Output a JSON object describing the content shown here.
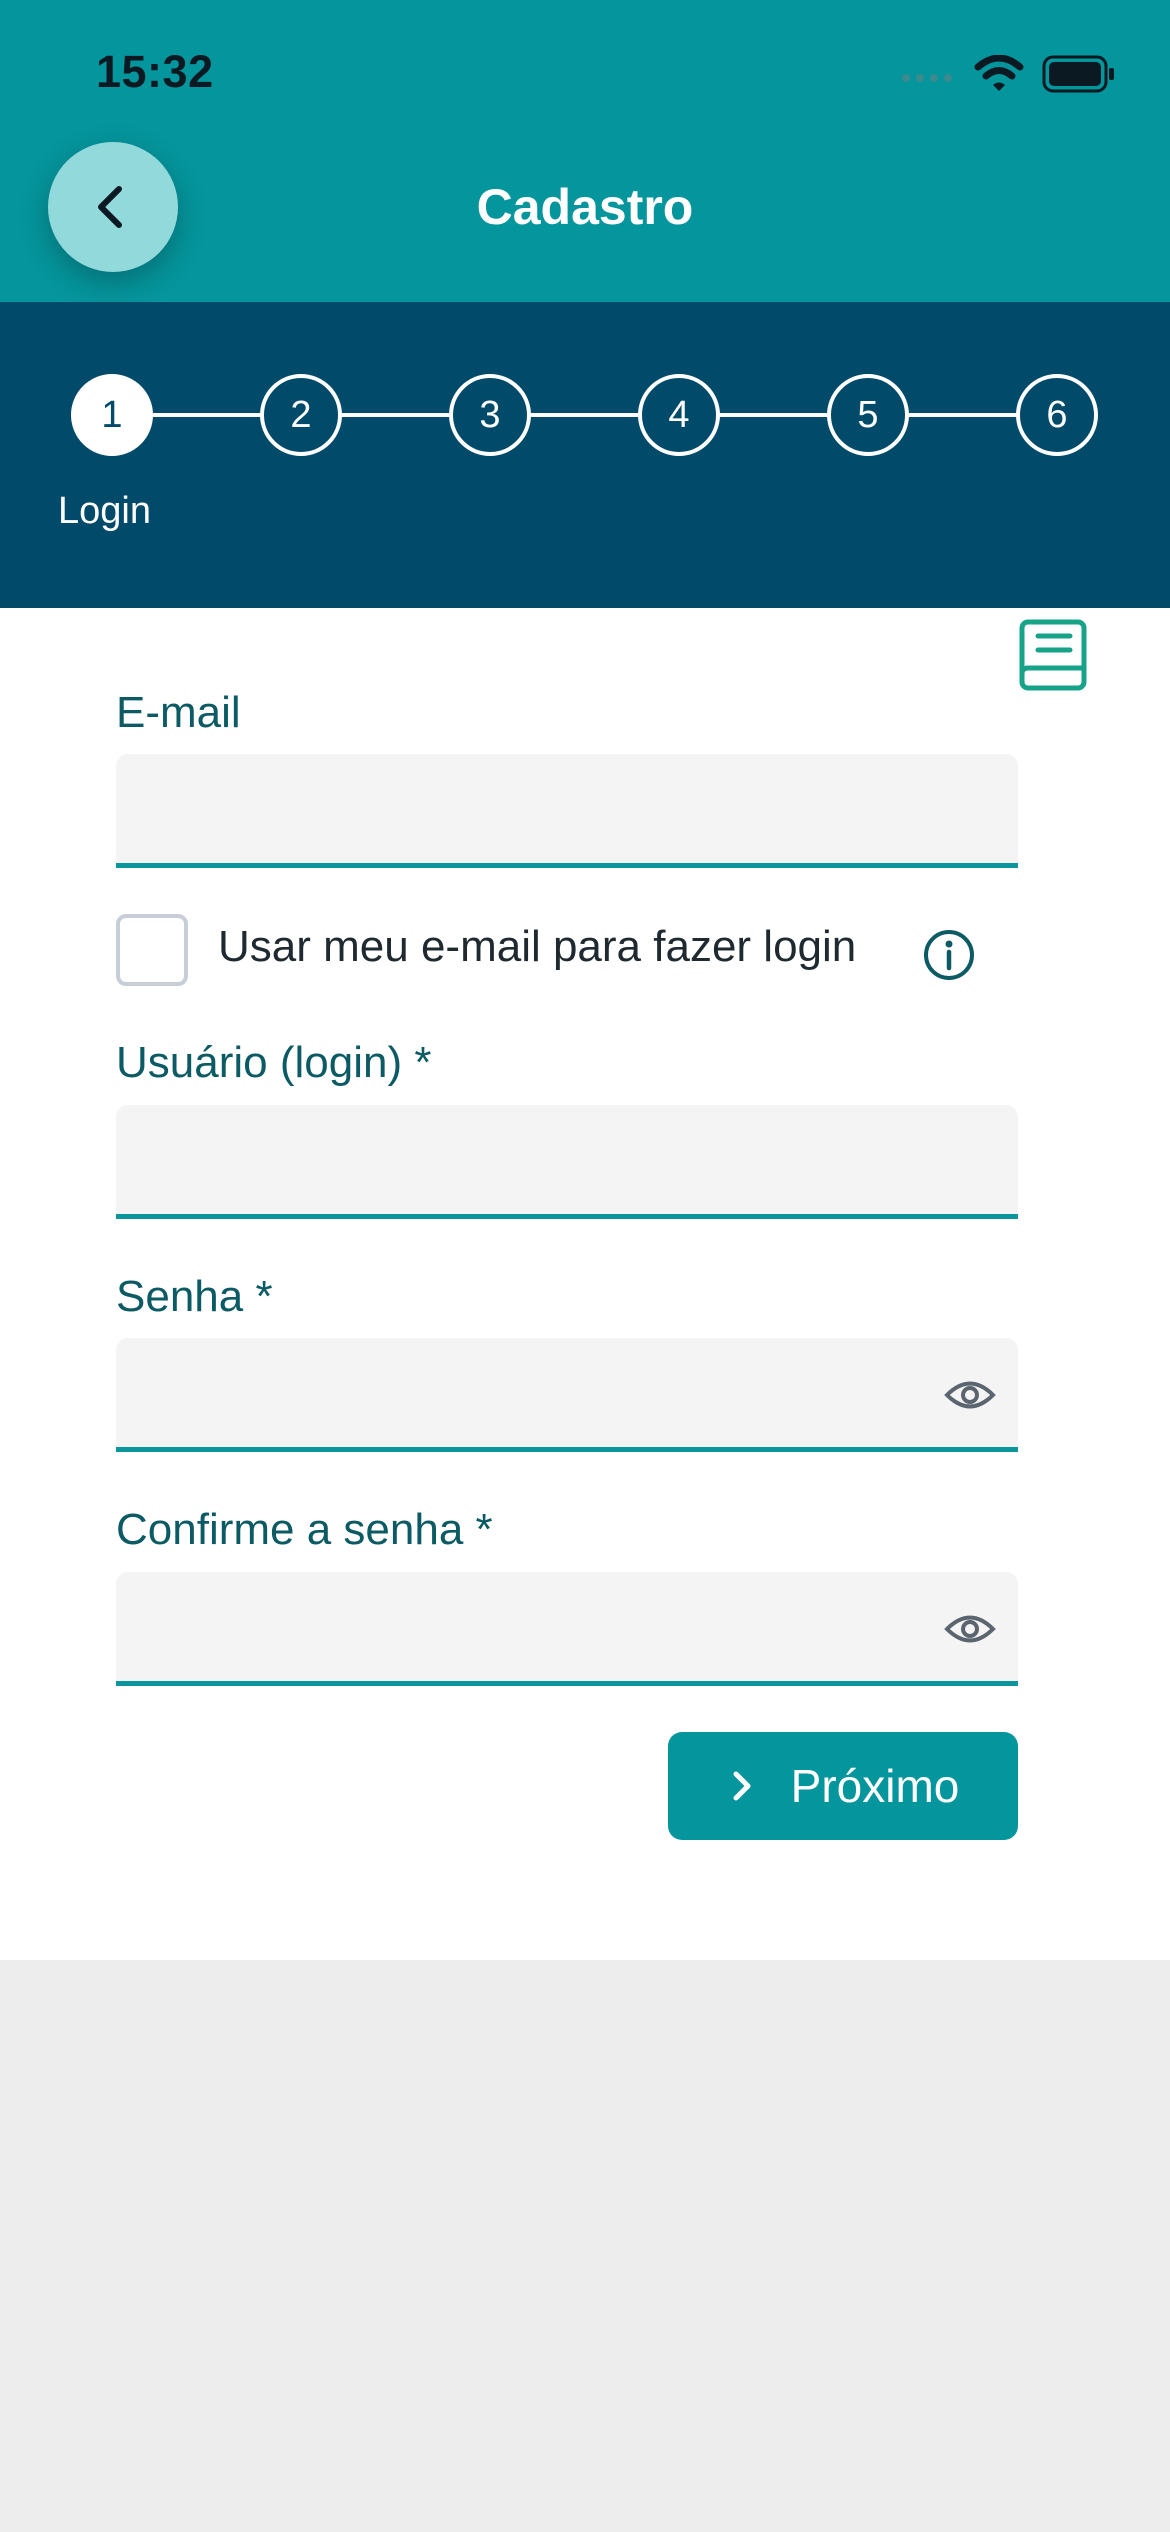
{
  "status_bar": {
    "time": "15:32"
  },
  "header": {
    "title": "Cadastro"
  },
  "stepper": {
    "steps": [
      "1",
      "2",
      "3",
      "4",
      "5",
      "6"
    ],
    "current_step_label": "Login"
  },
  "form": {
    "email": {
      "label": "E-mail",
      "value": ""
    },
    "use_email_checkbox": {
      "label": "Usar meu e-mail para fazer login",
      "checked": false
    },
    "username": {
      "label": "Usuário (login) *",
      "value": ""
    },
    "password": {
      "label": "Senha *",
      "value": ""
    },
    "confirm_password": {
      "label": "Confirme a senha *",
      "value": ""
    },
    "next_button": {
      "label": "Próximo"
    }
  },
  "icons": {
    "back": "chevron-left-icon",
    "manual": "book-icon",
    "info": "info-icon",
    "visibility": "eye-icon",
    "next": "chevron-right-icon"
  },
  "colors": {
    "header": "#05959c",
    "stepper": "#024a6a",
    "accent": "#0a969c",
    "label_text": "#0b5a64"
  }
}
